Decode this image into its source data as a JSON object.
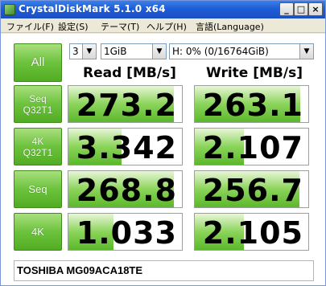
{
  "window": {
    "title": "CrystalDiskMark 5.1.0 x64",
    "minimize": "_",
    "maximize": "□",
    "close": "×"
  },
  "menu": [
    "ファイル(F)",
    "設定(S)",
    "テーマ(T)",
    "ヘルプ(H)",
    "言語(Language)"
  ],
  "controls": {
    "all_label": "All",
    "count_value": "3",
    "size_value": "1GiB",
    "drive_value": "H: 0% (0/16764GiB)"
  },
  "headers": {
    "read": "Read [MB/s]",
    "write": "Write [MB/s]"
  },
  "rows": [
    {
      "label_line1": "Seq",
      "label_line2": "Q32T1",
      "read": "273.2",
      "write": "263.1",
      "read_fill": 0.93,
      "write_fill": 0.93
    },
    {
      "label_line1": "4K",
      "label_line2": "Q32T1",
      "read": "3.342",
      "write": "2.107",
      "read_fill": 0.47,
      "write_fill": 0.43
    },
    {
      "label_line1": "Seq",
      "label_line2": "",
      "read": "268.8",
      "write": "256.7",
      "read_fill": 0.93,
      "write_fill": 0.92
    },
    {
      "label_line1": "4K",
      "label_line2": "",
      "read": "1.033",
      "write": "2.105",
      "read_fill": 0.4,
      "write_fill": 0.43
    }
  ],
  "comment": "TOSHIBA MG09ACA18TE",
  "colors": {
    "accent_green": "#6cc23c",
    "titlebar_blue": "#1f5cd6"
  }
}
